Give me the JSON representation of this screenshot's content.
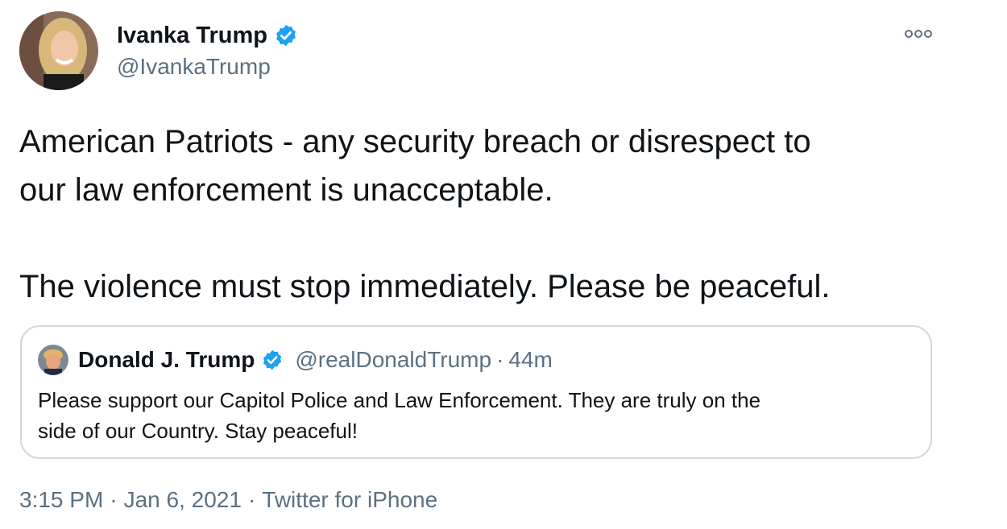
{
  "author": {
    "name": "Ivanka Trump",
    "handle": "@IvankaTrump",
    "verified": true,
    "avatar_icon": "profile-photo"
  },
  "more_icon": "more-options-icon",
  "tweet": {
    "lines": [
      "American Patriots - any security breach or disrespect to",
      "our law enforcement is unacceptable.",
      "",
      "The violence must stop immediately. Please be peaceful."
    ]
  },
  "quoted_tweet": {
    "name": "Donald J. Trump",
    "handle": "@realDonaldTrump",
    "separator": "·",
    "time": "44m",
    "verified": true,
    "text_lines": [
      "Please support our Capitol Police and Law Enforcement. They are truly on the",
      "side of our Country. Stay peaceful!"
    ]
  },
  "meta": {
    "time": "3:15 PM",
    "separator": "·",
    "date": "Jan 6, 2021",
    "source": "Twitter for iPhone"
  },
  "colors": {
    "verified_blue": "#1da1f2",
    "secondary_text": "#5b7083",
    "border": "#cfd9de",
    "primary_text": "#0f1419"
  }
}
